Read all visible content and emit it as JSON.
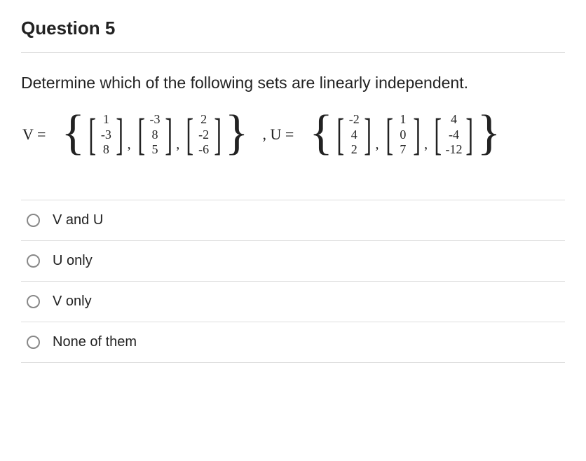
{
  "title": "Question 5",
  "prompt": "Determine which of the following sets are linearly independent.",
  "set_V": {
    "label": "V =",
    "vectors": [
      [
        "1",
        "-3",
        "8"
      ],
      [
        "-3",
        "8",
        "5"
      ],
      [
        "2",
        "-2",
        "-6"
      ]
    ]
  },
  "set_U": {
    "label": ", U =",
    "vectors": [
      [
        "-2",
        "4",
        "2"
      ],
      [
        "1",
        "0",
        "7"
      ],
      [
        "4",
        "-4",
        "-12"
      ]
    ]
  },
  "options": [
    {
      "label": "V and U"
    },
    {
      "label": "U only"
    },
    {
      "label": "V only"
    },
    {
      "label": "None of them"
    }
  ]
}
